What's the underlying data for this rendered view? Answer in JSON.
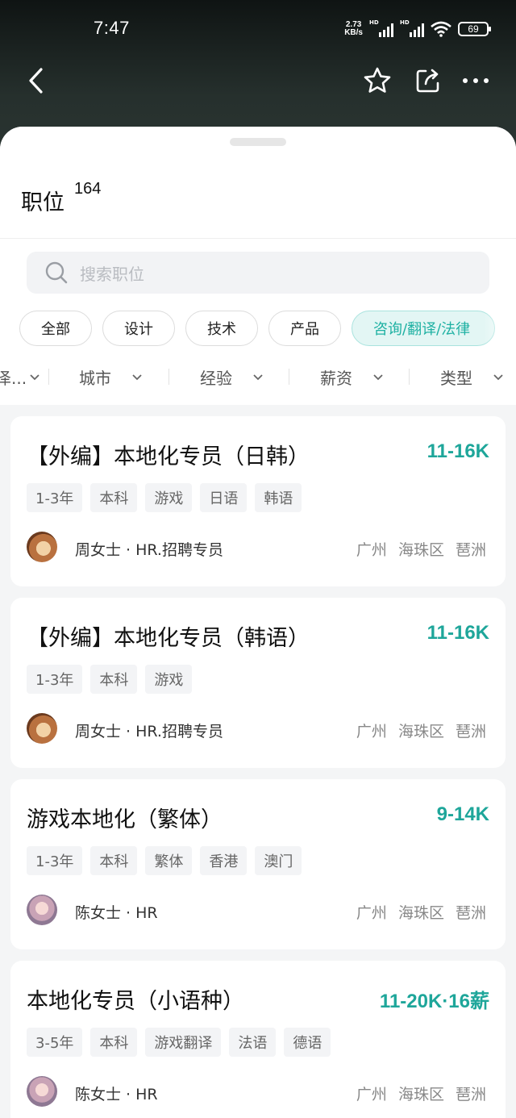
{
  "status": {
    "time": "7:47",
    "net_speed_top": "2.73",
    "net_speed_bottom": "KB/s",
    "signal_badge": "HD",
    "battery": "69"
  },
  "nav": {
    "back_icon": "chevron-left-icon",
    "favorite_icon": "star-icon",
    "share_icon": "share-icon",
    "more_icon": "more-horizontal-icon"
  },
  "header": {
    "title": "职位",
    "count": "164"
  },
  "search": {
    "placeholder": "搜索职位"
  },
  "categories": [
    {
      "label": "全部",
      "active": false
    },
    {
      "label": "设计",
      "active": false
    },
    {
      "label": "技术",
      "active": false
    },
    {
      "label": "产品",
      "active": false
    },
    {
      "label": "咨询/翻译/法律",
      "active": true
    }
  ],
  "filters": [
    {
      "label": "泽..."
    },
    {
      "label": "城市"
    },
    {
      "label": "经验"
    },
    {
      "label": "薪资"
    },
    {
      "label": "类型"
    }
  ],
  "jobs": [
    {
      "title": "【外编】本地化专员（日韩）",
      "salary": "11-16K",
      "tags": [
        "1-3年",
        "本科",
        "游戏",
        "日语",
        "韩语"
      ],
      "recruiter": "周女士 · HR.招聘专员",
      "location": "广州 海珠区 琶洲"
    },
    {
      "title": "【外编】本地化专员（韩语）",
      "salary": "11-16K",
      "tags": [
        "1-3年",
        "本科",
        "游戏"
      ],
      "recruiter": "周女士 · HR.招聘专员",
      "location": "广州 海珠区 琶洲"
    },
    {
      "title": "游戏本地化（繁体）",
      "salary": "9-14K",
      "tags": [
        "1-3年",
        "本科",
        "繁体",
        "香港",
        "澳门"
      ],
      "recruiter": "陈女士 · HR",
      "location": "广州 海珠区 琶洲"
    },
    {
      "title": "本地化专员（小语种）",
      "salary": "11-20K·16薪",
      "tags": [
        "3-5年",
        "本科",
        "游戏翻译",
        "法语",
        "德语"
      ],
      "recruiter": "陈女士 · HR",
      "location": "广州 海珠区 琶洲"
    }
  ],
  "colors": {
    "accent": "#1ea69a",
    "chip_active_bg": "#e3f6f4",
    "sheet_bg": "#f4f5f6"
  }
}
